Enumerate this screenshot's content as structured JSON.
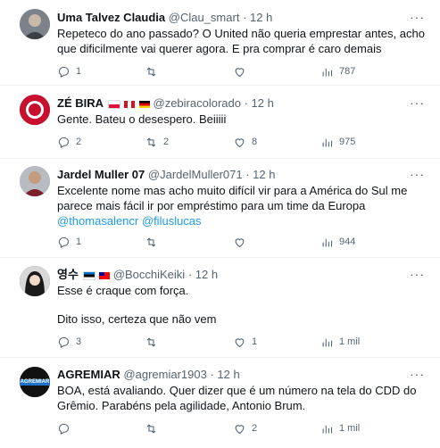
{
  "tweets": [
    {
      "name": "Uma Talvez Claudia",
      "handle": "@Clau_smart",
      "time": "· 12 h",
      "text": "Repeteco do ano passado? O United não queria emprestar antes, acho que dificilmente vai querer agora. E pra comprar é caro demais",
      "replies": "1",
      "retweets": "",
      "likes": "",
      "views": "787"
    },
    {
      "name": "ZÉ BIRA",
      "handle": "@zebiracolorado",
      "time": "· 12 h",
      "text": "Gente. Bateu o desespero. Beiiiii",
      "replies": "2",
      "retweets": "2",
      "likes": "8",
      "views": "975"
    },
    {
      "name": "Jardel Muller 07",
      "handle": "@JardelMuller071",
      "time": "· 12 h",
      "text": "Excelente nome mas acho muito difícil vir para a América do Sul me parece mais fácil ir por empréstimo para um time da Europa",
      "mention1": "@thomasalencr",
      "mention2": "@filuslucas",
      "replies": "1",
      "retweets": "",
      "likes": "",
      "views": "944"
    },
    {
      "name": "영수",
      "handle": "@BocchiKeiki",
      "time": "· 12 h",
      "text_line1": "Esse é craque com força.",
      "text_line2": "Dito isso, certeza que não vem",
      "replies": "3",
      "retweets": "",
      "likes": "1",
      "views": "1 mil"
    },
    {
      "name": "AGREMIAR",
      "handle": "@agremiar1903",
      "time": "· 12 h",
      "text": "BOA, está avaliando. Quer dizer que é um número na tela do CDD do Grêmio. Parabéns pela agilidade, Antonio Brum.",
      "avatar_text": "AGREMIAR",
      "replies": "",
      "retweets": "",
      "likes": "2",
      "views": "1 mil"
    }
  ],
  "more_symbol": "···"
}
